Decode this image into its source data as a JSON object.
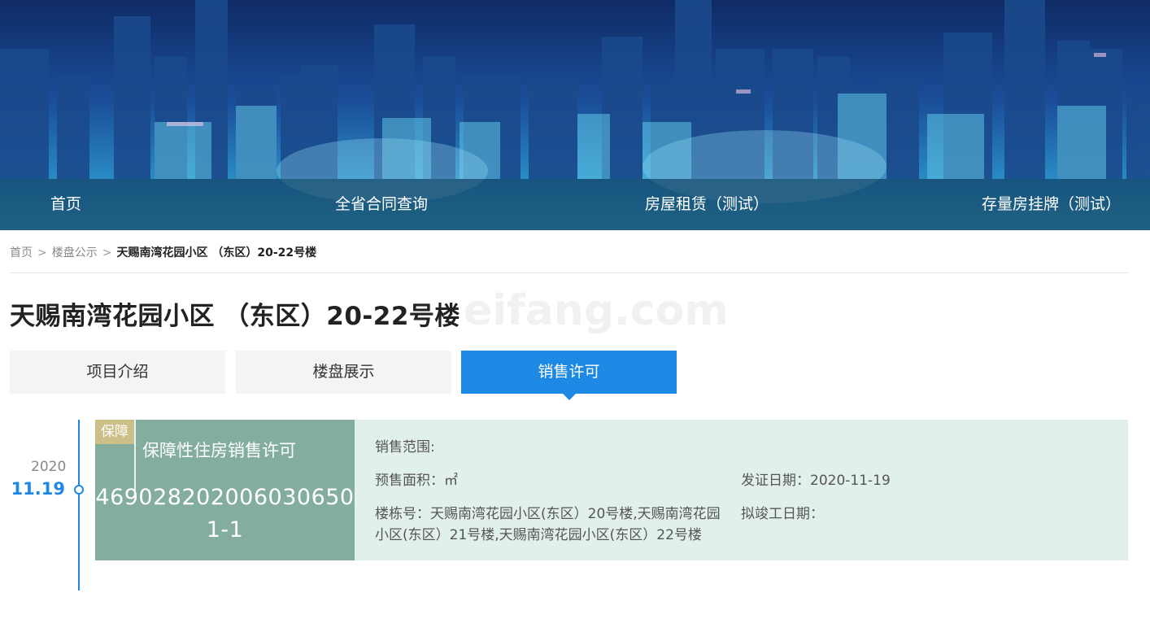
{
  "nav": {
    "items": [
      "首页",
      "全省合同查询",
      "房屋租赁（测试）",
      "存量房挂牌（测试）"
    ]
  },
  "breadcrumb": {
    "home": "首页",
    "section": "楼盘公示",
    "current": "天赐南湾花园小区 （东区）20-22号楼",
    "separator": ">"
  },
  "page": {
    "title": "天赐南湾花园小区 （东区）20-22号楼",
    "watermark": "eifang.com"
  },
  "tabs": [
    {
      "label": "项目介绍",
      "active": false
    },
    {
      "label": "楼盘展示",
      "active": false
    },
    {
      "label": "销售许可",
      "active": true
    }
  ],
  "timeline": {
    "year": "2020",
    "date": "11.19"
  },
  "permit": {
    "badge": "保障",
    "type": "保障性住房销售许可",
    "number": "469028202006030650​1-1",
    "scope_label": "销售范围:",
    "area_label": "预售面积：㎡",
    "issue_date_label": "发证日期：2020-11-19",
    "building_label": "楼栋号：天赐南湾花园小区(东区）20号楼,天赐南湾花园小区(东区）21号楼,天赐南湾花园小区(东区）22号楼",
    "completion_label": "拟竣工日期："
  },
  "colors": {
    "accent": "#1e88e5",
    "card_left": "#83ae9e",
    "card_right": "#e2f0eb",
    "badge": "#cdbf88"
  }
}
